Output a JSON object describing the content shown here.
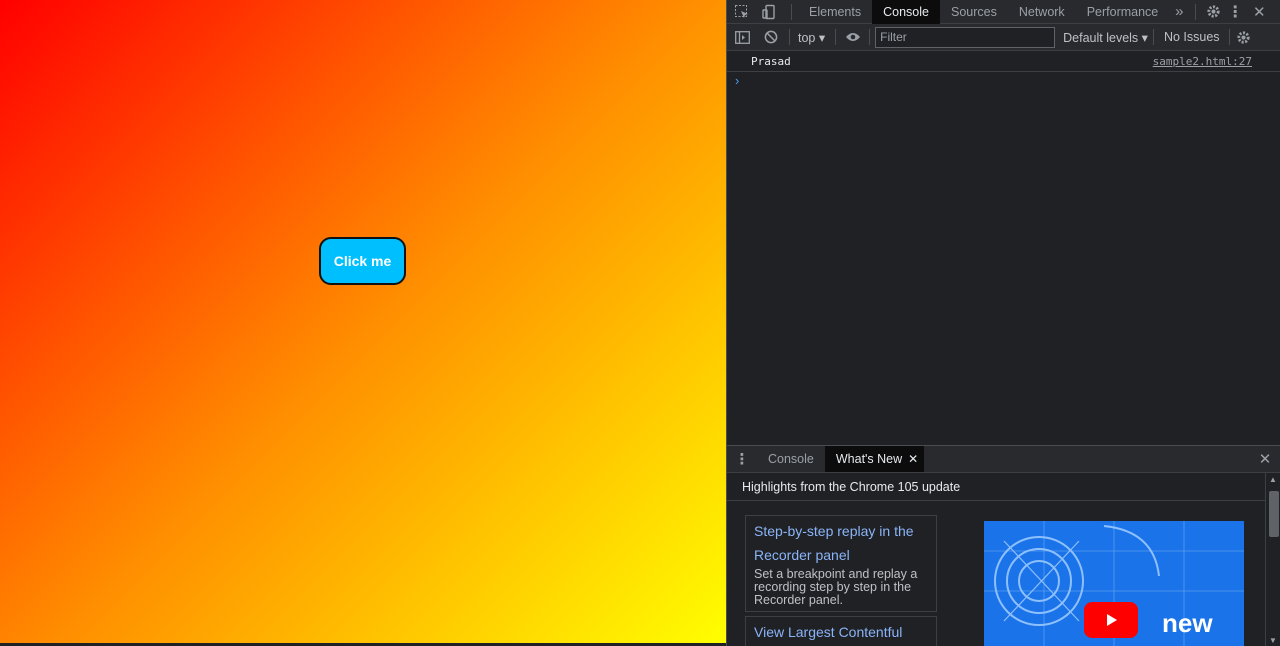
{
  "page": {
    "button_label": "Click me",
    "gradient_colors": [
      "#ff0000",
      "#ff8c00",
      "#ffff00"
    ]
  },
  "devtools": {
    "tabs": [
      {
        "label": "Elements",
        "active": false
      },
      {
        "label": "Console",
        "active": true
      },
      {
        "label": "Sources",
        "active": false
      },
      {
        "label": "Network",
        "active": false
      },
      {
        "label": "Performance",
        "active": false
      }
    ],
    "more_tabs_icon": "double-chevron-right",
    "console_toolbar": {
      "context": "top",
      "filter_placeholder": "Filter",
      "levels": "Default levels",
      "issues": "No Issues"
    },
    "console": {
      "log_message": "Prasad",
      "log_source": "sample2.html:27",
      "prompt": "›"
    },
    "drawer": {
      "tabs": [
        {
          "label": "Console",
          "active": false
        },
        {
          "label": "What's New",
          "active": true
        }
      ],
      "header": "Highlights from the Chrome 105 update",
      "cards": [
        {
          "title": "Step-by-step replay in the Recorder panel",
          "description": "Set a breakpoint and replay a recording step by step in the Recorder panel."
        },
        {
          "title": "View Largest Contentful",
          "description": ""
        }
      ],
      "video_label": "new"
    },
    "colors": {
      "accent_link": "#8ab4f8",
      "background": "#202124",
      "toolbar": "#292a2d"
    }
  }
}
